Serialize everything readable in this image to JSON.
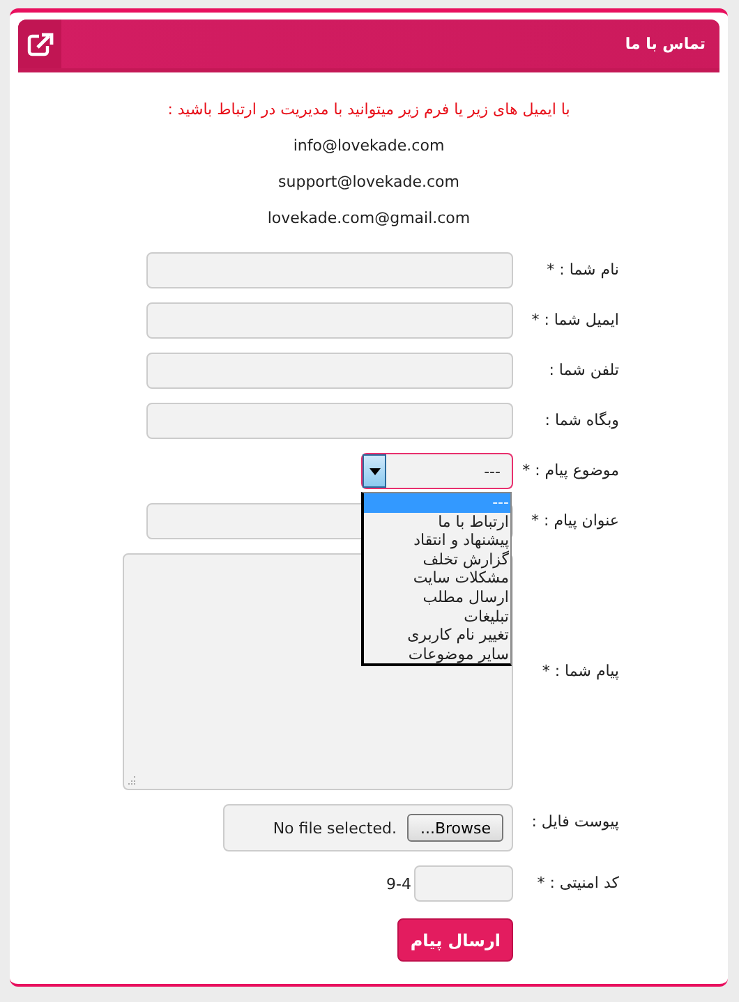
{
  "header": {
    "title": "تماس با ما"
  },
  "intro": "با ایمیل های زیر یا فرم زیر میتوانید با مدیریت در ارتباط باشید :",
  "emails": [
    "info@lovekade.com",
    "support@lovekade.com",
    "lovekade.com@gmail.com"
  ],
  "fields": [
    {
      "kind": "text",
      "label": "نام شما : *"
    },
    {
      "kind": "text",
      "label": "ایمیل شما : *"
    },
    {
      "kind": "text",
      "label": "تلفن شما :"
    },
    {
      "kind": "text",
      "label": "وبگاه شما :"
    },
    {
      "kind": "select",
      "label": "موضوع پیام : *",
      "value": "---",
      "expanded": true,
      "options": [
        {
          "label": "---",
          "selected": true
        },
        {
          "label": "ارتباط با ما",
          "selected": false
        },
        {
          "label": "پیشنهاد و انتقاد",
          "selected": false
        },
        {
          "label": "گزارش تخلف",
          "selected": false
        },
        {
          "label": "مشکلات سایت",
          "selected": false
        },
        {
          "label": "ارسال مطلب",
          "selected": false
        },
        {
          "label": "تبلیغات",
          "selected": false
        },
        {
          "label": "تغییر نام کاربری",
          "selected": false
        },
        {
          "label": "سایر موضوعات",
          "selected": false
        }
      ]
    },
    {
      "kind": "text",
      "label": "عنوان پیام : *"
    },
    {
      "kind": "textarea",
      "label": "پیام شما : *"
    },
    {
      "kind": "file",
      "label": "پیوست فایل :",
      "button": "...Browse",
      "status": "No file selected."
    },
    {
      "kind": "captcha",
      "label": "کد امنیتی : *",
      "code": "9-4"
    }
  ],
  "submit": "ارسال پیام"
}
